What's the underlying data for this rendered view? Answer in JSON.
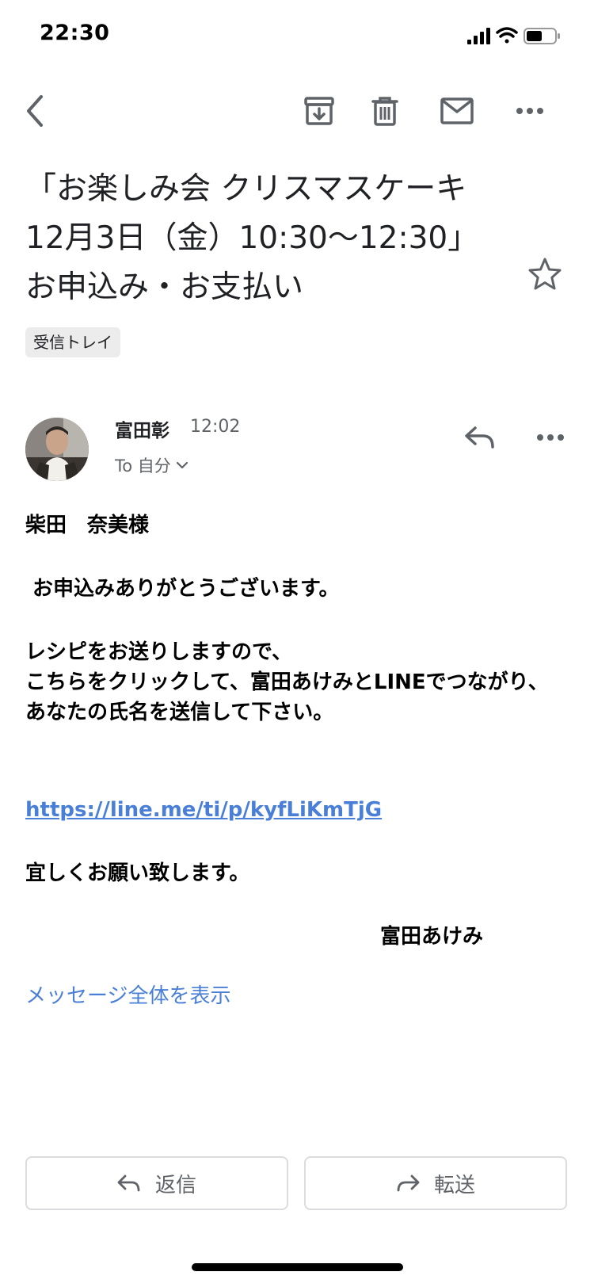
{
  "status_bar": {
    "time": "22:30"
  },
  "toolbar": {
    "icons": [
      "back-icon",
      "archive-icon",
      "trash-icon",
      "mail-icon",
      "more-icon"
    ]
  },
  "email": {
    "subject": "「お楽しみ会 クリスマスケーキ　12月3日（金）10:30〜12:30」お申込み・お支払い",
    "label": "受信トレイ",
    "sender_name": "富田彰",
    "time": "12:02",
    "recipient": "To 自分",
    "greeting": "柴田　奈美様",
    "thanks": " お申込みありがとうございます。",
    "para_line1": "レシピをお送りしますので、",
    "para_line2": "こちらをクリックして、富田あけみとLINEでつながり、",
    "para_line3": "あなたの氏名を送信して下さい。",
    "link": "https://line.me/ti/p/kyfLiKmTjG",
    "closing": "宜しくお願い致します。",
    "signature": "富田あけみ",
    "show_all": "メッセージ全体を表示"
  },
  "actions": {
    "reply": "返信",
    "forward": "転送"
  },
  "colors": {
    "link": "#4a7fd7",
    "icon_gray": "#5f6368"
  }
}
